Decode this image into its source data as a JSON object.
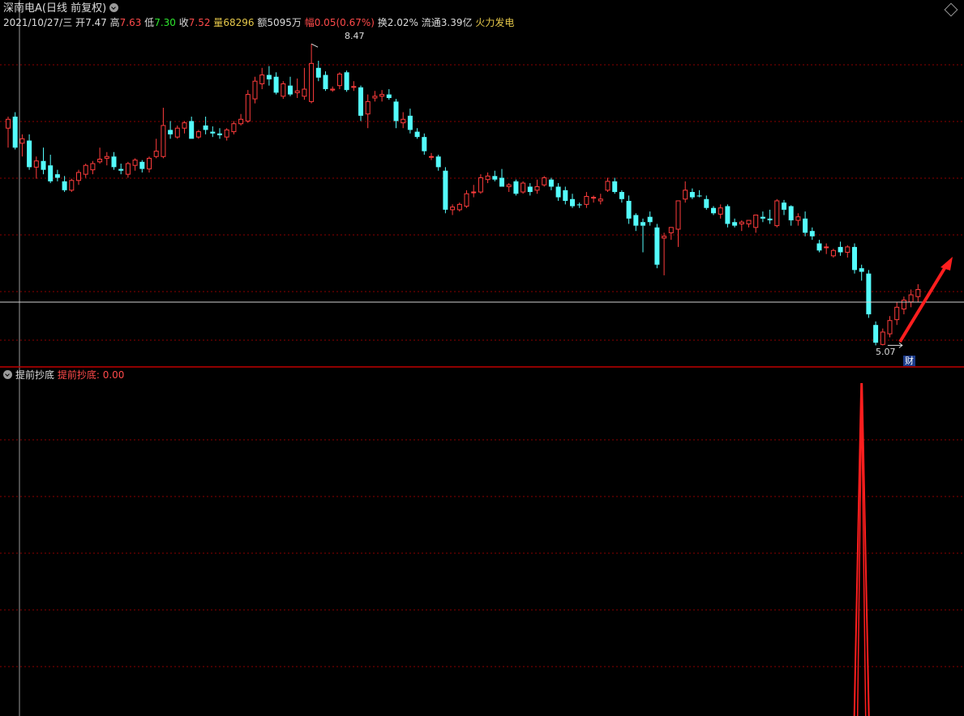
{
  "header": {
    "title": "深南电A(日线 前复权)",
    "date": "2021/10/27/三",
    "open_label": "开",
    "open_value": "7.47",
    "high_label": "高",
    "high_value": "7.63",
    "low_label": "低",
    "low_value": "7.30",
    "close_label": "收",
    "close_value": "7.52",
    "volume_label": "量",
    "volume_value": "68296",
    "amount_label": "额",
    "amount_value": "5095万",
    "change_label": "幅",
    "change_value": "0.05(0.67%)",
    "turnover_label": "换",
    "turnover_value": "2.02%",
    "float_label": "流通",
    "float_value": "3.39亿",
    "concept": "火力发电"
  },
  "annotations": {
    "high_price": "8.47",
    "low_price": "5.07",
    "event_badge": "财"
  },
  "indicator": {
    "name": "提前抄底",
    "series_label": "提前抄底:",
    "value": "0.00"
  },
  "colors": {
    "up": "#ff3c3c",
    "down": "#54fcfc",
    "grid": "#8b0000",
    "background": "#000000",
    "arrow": "#ff1e1e"
  },
  "chart_data": [
    {
      "type": "candlestick",
      "ylim": [
        4.9,
        8.6
      ],
      "ohlc": [
        [
          7.52,
          7.65,
          7.3,
          7.62
        ],
        [
          7.65,
          7.7,
          7.28,
          7.3
        ],
        [
          7.35,
          7.45,
          7.2,
          7.4
        ],
        [
          7.38,
          7.45,
          7.05,
          7.08
        ],
        [
          7.08,
          7.2,
          6.95,
          7.15
        ],
        [
          7.15,
          7.3,
          7.0,
          7.05
        ],
        [
          7.1,
          7.22,
          6.9,
          6.92
        ],
        [
          7.0,
          7.05,
          6.92,
          6.96
        ],
        [
          6.92,
          6.98,
          6.8,
          6.82
        ],
        [
          6.82,
          6.95,
          6.8,
          6.93
        ],
        [
          6.93,
          7.05,
          6.88,
          7.02
        ],
        [
          7.0,
          7.12,
          6.96,
          7.1
        ],
        [
          7.05,
          7.15,
          7.0,
          7.12
        ],
        [
          7.14,
          7.3,
          7.12,
          7.17
        ],
        [
          7.18,
          7.25,
          7.1,
          7.2
        ],
        [
          7.2,
          7.25,
          7.05,
          7.08
        ],
        [
          7.06,
          7.12,
          7.0,
          7.04
        ],
        [
          7.0,
          7.14,
          6.96,
          7.12
        ],
        [
          7.1,
          7.18,
          7.04,
          7.16
        ],
        [
          7.14,
          7.16,
          7.02,
          7.06
        ],
        [
          7.06,
          7.2,
          7.02,
          7.18
        ],
        [
          7.2,
          7.4,
          7.18,
          7.26
        ],
        [
          7.2,
          7.75,
          7.18,
          7.55
        ],
        [
          7.5,
          7.6,
          7.4,
          7.45
        ],
        [
          7.42,
          7.55,
          7.4,
          7.52
        ],
        [
          7.52,
          7.6,
          7.46,
          7.58
        ],
        [
          7.6,
          7.65,
          7.5,
          7.4
        ],
        [
          7.42,
          7.5,
          7.4,
          7.48
        ],
        [
          7.55,
          7.65,
          7.45,
          7.5
        ],
        [
          7.48,
          7.54,
          7.42,
          7.46
        ],
        [
          7.46,
          7.52,
          7.4,
          7.44
        ],
        [
          7.42,
          7.52,
          7.38,
          7.5
        ],
        [
          7.48,
          7.6,
          7.45,
          7.57
        ],
        [
          7.57,
          7.68,
          7.55,
          7.62
        ],
        [
          7.6,
          7.95,
          7.58,
          7.9
        ],
        [
          7.85,
          8.1,
          7.8,
          8.05
        ],
        [
          8.02,
          8.2,
          7.96,
          8.12
        ],
        [
          8.12,
          8.22,
          8.0,
          8.07
        ],
        [
          8.1,
          8.15,
          7.9,
          7.92
        ],
        [
          7.88,
          8.05,
          7.85,
          8.02
        ],
        [
          8.0,
          8.1,
          7.88,
          7.9
        ],
        [
          7.92,
          8.08,
          7.86,
          7.94
        ],
        [
          7.88,
          8.2,
          7.84,
          7.96
        ],
        [
          7.82,
          8.47,
          7.8,
          8.25
        ],
        [
          8.2,
          8.28,
          8.05,
          8.09
        ],
        [
          8.12,
          8.16,
          7.94,
          7.96
        ],
        [
          7.95,
          7.99,
          7.93,
          7.96
        ],
        [
          8.0,
          8.15,
          7.96,
          8.13
        ],
        [
          8.15,
          8.17,
          7.93,
          7.95
        ],
        [
          7.98,
          8.05,
          7.94,
          7.99
        ],
        [
          7.98,
          8.0,
          7.6,
          7.66
        ],
        [
          7.68,
          7.9,
          7.52,
          7.82
        ],
        [
          7.86,
          7.94,
          7.82,
          7.88
        ],
        [
          7.88,
          7.95,
          7.82,
          7.9
        ],
        [
          7.9,
          7.96,
          7.84,
          7.86
        ],
        [
          7.82,
          7.85,
          7.52,
          7.6
        ],
        [
          7.58,
          7.7,
          7.52,
          7.62
        ],
        [
          7.66,
          7.74,
          7.46,
          7.5
        ],
        [
          7.48,
          7.52,
          7.4,
          7.42
        ],
        [
          7.42,
          7.46,
          7.22,
          7.26
        ],
        [
          7.2,
          7.24,
          7.16,
          7.2
        ],
        [
          7.2,
          7.22,
          7.04,
          7.08
        ],
        [
          7.04,
          7.08,
          6.56,
          6.6
        ],
        [
          6.6,
          6.66,
          6.54,
          6.63
        ],
        [
          6.6,
          6.68,
          6.58,
          6.66
        ],
        [
          6.64,
          6.82,
          6.62,
          6.78
        ],
        [
          6.8,
          6.88,
          6.74,
          6.8
        ],
        [
          6.8,
          7.0,
          6.78,
          6.96
        ],
        [
          6.94,
          7.02,
          6.9,
          6.98
        ],
        [
          6.98,
          7.04,
          6.92,
          6.94
        ],
        [
          6.96,
          7.06,
          6.92,
          6.86
        ],
        [
          6.86,
          6.9,
          6.8,
          6.88
        ],
        [
          6.92,
          6.94,
          6.76,
          6.78
        ],
        [
          6.8,
          6.92,
          6.78,
          6.9
        ],
        [
          6.86,
          6.9,
          6.76,
          6.8
        ],
        [
          6.82,
          6.94,
          6.78,
          6.86
        ],
        [
          6.88,
          6.98,
          6.86,
          6.96
        ],
        [
          6.94,
          6.96,
          6.82,
          6.86
        ],
        [
          6.86,
          6.9,
          6.7,
          6.74
        ],
        [
          6.82,
          6.86,
          6.66,
          6.7
        ],
        [
          6.72,
          6.78,
          6.62,
          6.64
        ],
        [
          6.66,
          6.68,
          6.62,
          6.65
        ],
        [
          6.66,
          6.8,
          6.62,
          6.75
        ],
        [
          6.74,
          6.76,
          6.68,
          6.74
        ],
        [
          6.7,
          6.78,
          6.66,
          6.72
        ],
        [
          6.82,
          6.96,
          6.8,
          6.92
        ],
        [
          6.92,
          6.96,
          6.78,
          6.8
        ],
        [
          6.8,
          6.82,
          6.68,
          6.72
        ],
        [
          6.7,
          6.76,
          6.44,
          6.5
        ],
        [
          6.54,
          6.56,
          6.36,
          6.42
        ],
        [
          6.46,
          6.5,
          6.12,
          6.42
        ],
        [
          6.52,
          6.58,
          6.42,
          6.46
        ],
        [
          6.4,
          6.44,
          5.94,
          5.98
        ],
        [
          6.28,
          6.34,
          5.86,
          6.3
        ],
        [
          6.34,
          6.4,
          6.26,
          6.4
        ],
        [
          6.38,
          6.6,
          6.18,
          6.7
        ],
        [
          6.72,
          6.92,
          6.68,
          6.82
        ],
        [
          6.8,
          6.84,
          6.72,
          6.74
        ],
        [
          6.76,
          6.82,
          6.74,
          6.75
        ],
        [
          6.72,
          6.76,
          6.6,
          6.62
        ],
        [
          6.62,
          6.64,
          6.54,
          6.56
        ],
        [
          6.55,
          6.66,
          6.5,
          6.62
        ],
        [
          6.64,
          6.66,
          6.4,
          6.44
        ],
        [
          6.46,
          6.5,
          6.4,
          6.42
        ],
        [
          6.44,
          6.48,
          6.36,
          6.46
        ],
        [
          6.44,
          6.48,
          6.4,
          6.48
        ],
        [
          6.4,
          6.54,
          6.34,
          6.54
        ],
        [
          6.52,
          6.58,
          6.46,
          6.5
        ],
        [
          6.5,
          6.6,
          6.44,
          6.48
        ],
        [
          6.42,
          6.72,
          6.4,
          6.7
        ],
        [
          6.68,
          6.71,
          6.54,
          6.6
        ],
        [
          6.64,
          6.65,
          6.42,
          6.48
        ],
        [
          6.48,
          6.56,
          6.42,
          6.52
        ],
        [
          6.5,
          6.58,
          6.3,
          6.34
        ],
        [
          6.36,
          6.4,
          6.26,
          6.3
        ],
        [
          6.22,
          6.26,
          6.12,
          6.14
        ],
        [
          6.18,
          6.22,
          6.1,
          6.18
        ],
        [
          6.08,
          6.16,
          6.06,
          6.14
        ],
        [
          6.18,
          6.24,
          6.08,
          6.12
        ],
        [
          6.12,
          6.2,
          6.06,
          6.18
        ],
        [
          6.18,
          6.22,
          5.88,
          5.92
        ],
        [
          5.94,
          5.98,
          5.8,
          5.9
        ],
        [
          5.88,
          5.92,
          5.38,
          5.42
        ],
        [
          5.3,
          5.34,
          5.07,
          5.1
        ],
        [
          5.08,
          5.26,
          5.07,
          5.22
        ],
        [
          5.2,
          5.4,
          5.16,
          5.35
        ],
        [
          5.36,
          5.56,
          5.3,
          5.5
        ],
        [
          5.48,
          5.62,
          5.42,
          5.58
        ],
        [
          5.56,
          5.7,
          5.5,
          5.64
        ],
        [
          5.62,
          5.76,
          5.56,
          5.7
        ]
      ]
    },
    {
      "type": "line",
      "name": "提前抄底",
      "ylim": [
        0,
        1
      ],
      "signal_bar": 121,
      "signal_value": 1
    }
  ]
}
